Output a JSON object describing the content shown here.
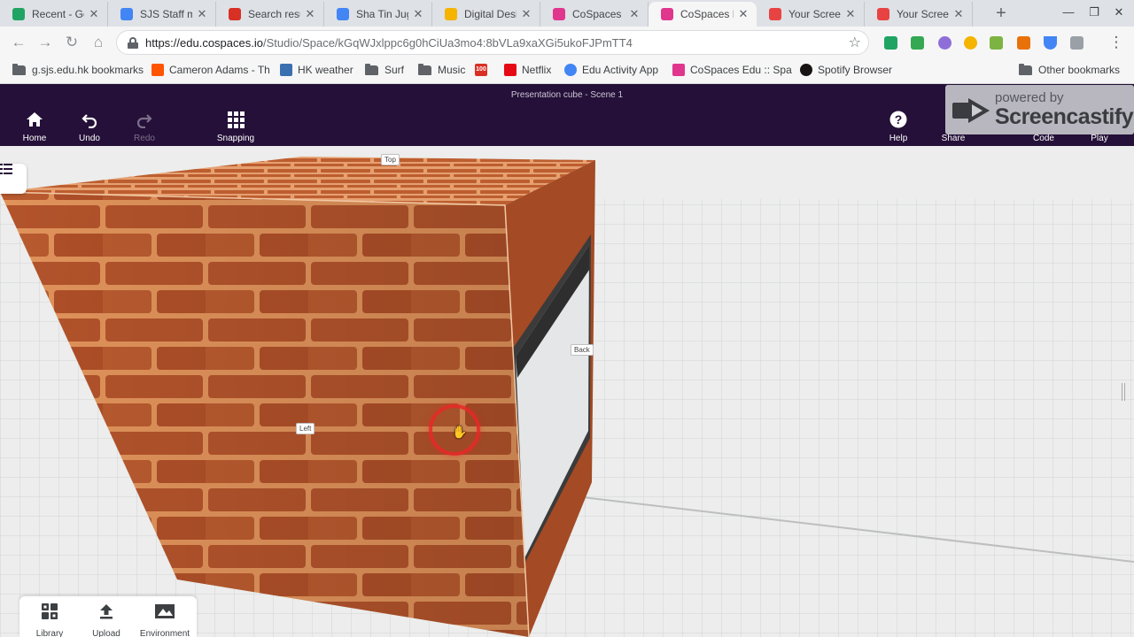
{
  "browser": {
    "tabs": [
      {
        "label": "Recent - Goo",
        "favicon": "google-drive-icon",
        "color": "#1fa463"
      },
      {
        "label": "SJS Staff m",
        "favicon": "google-docs-icon",
        "color": "#4285f4"
      },
      {
        "label": "Search resu",
        "favicon": "100-emoji-icon",
        "color": "#d93025"
      },
      {
        "label": "Sha Tin Jug",
        "favicon": "calendar-icon",
        "color": "#4285f4"
      },
      {
        "label": "Digital Desi",
        "favicon": "google-slides-icon",
        "color": "#f4b400"
      },
      {
        "label": "CoSpaces E",
        "favicon": "cospaces-icon",
        "color": "#e0368e"
      },
      {
        "label": "CoSpaces E",
        "favicon": "cospaces-icon",
        "color": "#e0368e"
      },
      {
        "label": "Your Screen",
        "favicon": "screencastify-icon",
        "color": "#e84343"
      },
      {
        "label": "Your Screen",
        "favicon": "screencastify-icon",
        "color": "#e84343"
      }
    ],
    "active_tab": 6,
    "url_host": "https://edu.cospaces.io",
    "url_path": "/Studio/Space/kGqWJxlppc6g0hCiUa3mo4:8bVLa9xaXGi5ukoFJPmTT4",
    "bookmarks": [
      {
        "label": "g.sjs.edu.hk bookmarks",
        "icon": "folder-icon"
      },
      {
        "label": "Cameron Adams - Th",
        "icon": "soundcloud-icon",
        "color": "#ff5500"
      },
      {
        "label": "HK weather",
        "icon": "weather-icon",
        "color": "#3a6fb0"
      },
      {
        "label": "Surf",
        "icon": "folder-icon"
      },
      {
        "label": "Music",
        "icon": "folder-icon"
      },
      {
        "label": "100",
        "icon": "100-emoji-icon",
        "color": "#d93025"
      },
      {
        "label": "Netflix",
        "icon": "netflix-icon",
        "color": "#e50914"
      },
      {
        "label": "Edu Activity App",
        "icon": "google-icon",
        "color": "#4285f4"
      },
      {
        "label": "CoSpaces Edu :: Spa",
        "icon": "cospaces-icon",
        "color": "#e0368e"
      },
      {
        "label": "Spotify Browser",
        "icon": "spotify-icon",
        "color": "#191414"
      },
      {
        "label": "Other bookmarks",
        "icon": "folder-icon"
      }
    ]
  },
  "app": {
    "scene_title": "Presentation cube - Scene 1",
    "toolbar": {
      "home": "Home",
      "undo": "Undo",
      "redo": "Redo",
      "snapping": "Snapping",
      "help": "Help",
      "share": "Share",
      "code": "Code",
      "play": "Play"
    },
    "watermark": {
      "line1": "powered by",
      "brand": "Screencastify"
    },
    "face_labels": {
      "top": "Top",
      "left": "Left",
      "back": "Back"
    },
    "bottom": {
      "library": "Library",
      "upload": "Upload",
      "environment": "Environment"
    },
    "colors": {
      "header": "#241038",
      "brick": "#b2532b",
      "mortar": "#e0925a"
    }
  }
}
